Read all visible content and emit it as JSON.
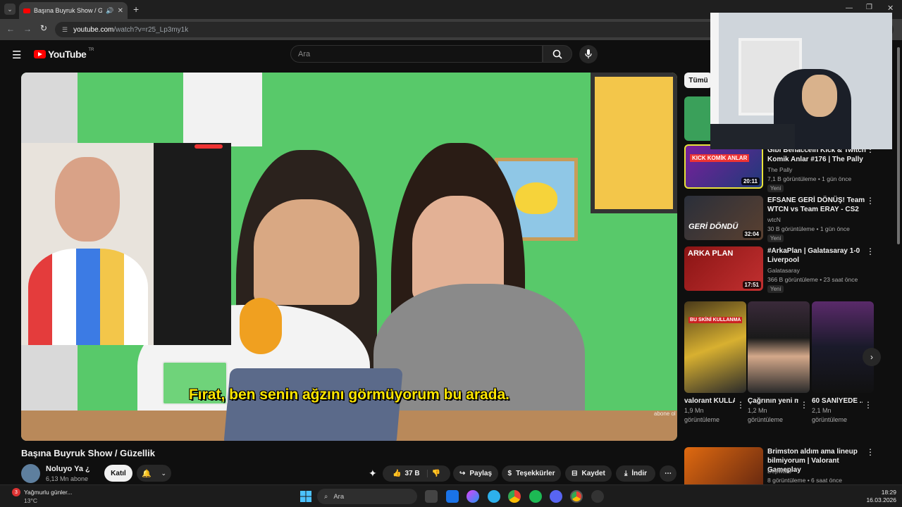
{
  "browser": {
    "tab_title": "Başına Buyruk Show / Güze...",
    "url_host": "youtube.com",
    "url_path": "/watch?v=r25_Lp3my1k"
  },
  "header": {
    "logo_text": "YouTube",
    "logo_region": "TR",
    "search_placeholder": "Ara"
  },
  "video": {
    "subtitle": "Fırat, ben senin ağzını görmüyorum bu arada.",
    "watermark": "abone ol",
    "title": "Başına Buyruk Show / Güzellik"
  },
  "channel": {
    "name": "Noluyo Ya ¿",
    "subscribers": "6,13 Mn abone",
    "join_label": "Katıl"
  },
  "actions": {
    "likes": "37 B",
    "share": "Paylaş",
    "thanks": "Teşekkürler",
    "save": "Kaydet",
    "download": "İndir"
  },
  "sidebar": {
    "chip": "Tümü",
    "recommendations": [
      {
        "title": "Gibi Benaccein Kick & Twitch Komik Anlar #176 | The Pally",
        "channel": "The Pally",
        "views": "7,1 B görüntüleme",
        "age": "1 gün önce",
        "badge": "Yeni",
        "duration": "20:11",
        "thumb_text": "KICK KOMİK ANLAR"
      },
      {
        "title": "EFSANE GERİ DÖNÜŞ! Team WTCN vs Team ERAY - CS2",
        "channel": "wtcN",
        "views": "30 B görüntüleme",
        "age": "1 gün önce",
        "badge": "Yeni",
        "duration": "32:04",
        "thumb_text": "GERİ DÖNDÜ"
      },
      {
        "title": "#ArkaPlan | Galatasaray 1-0 Liverpool",
        "channel": "Galatasaray",
        "views": "366 B görüntüleme",
        "age": "23 saat önce",
        "badge": "Yeni",
        "duration": "17:51",
        "thumb_text": "ARKA PLAN"
      },
      {
        "title": "Brimston aldım ama lineup bilmiyorum | Valorant Gameplay",
        "channel": "Depwaro",
        "views": "8 görüntüleme",
        "age": "6 saat önce",
        "badge": "",
        "duration": "",
        "thumb_text": ""
      }
    ],
    "shorts": [
      {
        "title": "valorant KULLANM...",
        "views": "1,9 Mn",
        "views_suffix": "görüntüleme",
        "thumb_text": "BU SKİNİ KULLANMA"
      },
      {
        "title": "Çağrının yeni manitası ...",
        "views": "1,2 Mn",
        "views_suffix": "görüntüleme",
        "thumb_text": ""
      },
      {
        "title": "60 SANİYEDE ...",
        "views": "2,1 Mn",
        "views_suffix": "görüntüleme",
        "thumb_text": ""
      }
    ]
  },
  "taskbar": {
    "weather_text": "Yağmurlu günler...",
    "temperature": "13°C",
    "search_placeholder": "Ara",
    "time": "18:29",
    "date": "16.03.2026",
    "notification_count": "3"
  },
  "colors": {
    "accent_red": "#ff0000",
    "background": "#0f0f0f",
    "subtitle_yellow": "#ffe600"
  }
}
